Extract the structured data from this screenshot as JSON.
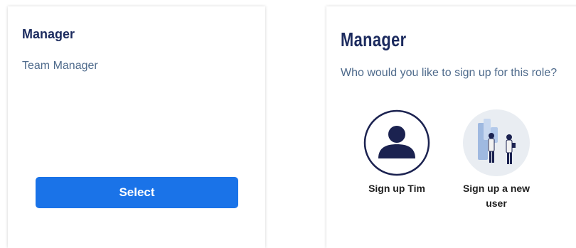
{
  "left_card": {
    "title": "Manager",
    "subtitle": "Team Manager",
    "select_label": "Select"
  },
  "right_card": {
    "title": "Manager",
    "question": "Who would you like to sign up for this role?",
    "options": [
      {
        "label": "Sign up Tim",
        "icon": "user-avatar-icon"
      },
      {
        "label": "Sign up a new user",
        "icon": "new-user-illustration-icon"
      }
    ]
  },
  "colors": {
    "accent": "#1a73e8",
    "title": "#1b2a5e",
    "subtitle": "#4f6b8c"
  }
}
